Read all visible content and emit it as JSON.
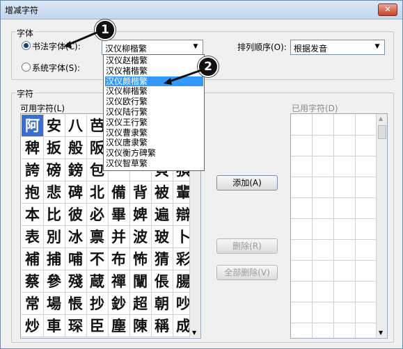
{
  "window": {
    "title": "增减字符",
    "close_glyph": "✕"
  },
  "font_group": {
    "label": "字体",
    "calligraphy_radio": "书法字体(C):",
    "system_radio": "系统字体(S):",
    "calligraphy_value": "汉仪柳楷繁",
    "sort_label": "排列顺序(O):",
    "sort_value": "根据发音"
  },
  "dropdown_items": [
    "汉仪赵楷繁",
    "汉仪褚楷繁",
    "汉仪颜楷繁",
    "汉仪柳楷繁",
    "汉仪欧行繁",
    "汉仪陆行繁",
    "汉仪王行繁",
    "汉仪曹隶繁",
    "汉仪唐隶繁",
    "汉仪衡方碑繁",
    "汉仪智草繁"
  ],
  "dropdown_selected_index": 2,
  "char_group": {
    "label": "字符",
    "available_label": "可用字符(L)",
    "used_label": "已用字符(D)"
  },
  "buttons": {
    "add": "添加(A)",
    "delete": "删除(R)",
    "delete_all": "全部删除(V)"
  },
  "characters": [
    [
      "阿",
      "安",
      "八",
      "芭",
      "",
      "",
      "",
      ""
    ],
    [
      "稗",
      "扳",
      "般",
      "阪",
      "",
      "",
      "",
      ""
    ],
    [
      "誇",
      "磅",
      "鎊",
      "包",
      "",
      "",
      "貝",
      "狽"
    ],
    [
      "抱",
      "悲",
      "碑",
      "北",
      "備",
      "背",
      "被",
      "輩"
    ],
    [
      "本",
      "比",
      "彼",
      "必",
      "畢",
      "婢",
      "遍",
      "辯"
    ],
    [
      "表",
      "別",
      "冰",
      "禀",
      "并",
      "波",
      "玻",
      "卜"
    ],
    [
      "補",
      "捕",
      "哺",
      "不",
      "布",
      "怖",
      "猜",
      "彩"
    ],
    [
      "蔡",
      "參",
      "殘",
      "蔵",
      "禪",
      "闡",
      "倀",
      "腸"
    ],
    [
      "常",
      "場",
      "悵",
      "抄",
      "鈔",
      "超",
      "朝",
      "吵"
    ],
    [
      "炒",
      "車",
      "琛",
      "臣",
      "塵",
      "陳",
      "稱",
      "成"
    ]
  ],
  "callouts": [
    "1",
    "2"
  ],
  "scroll_arrows": {
    "up": "▲",
    "down": "▼"
  }
}
